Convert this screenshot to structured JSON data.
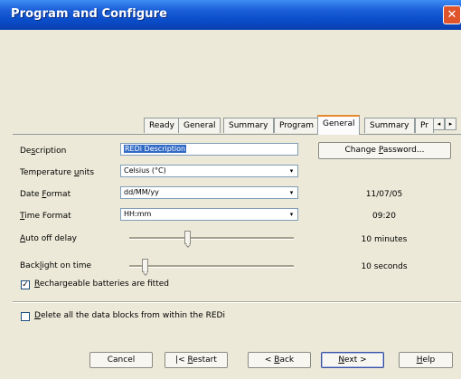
{
  "window": {
    "title": "Program and Configure",
    "close_glyph": "✕"
  },
  "tabs": [
    {
      "label": "Ready"
    },
    {
      "label": "General"
    },
    {
      "label": "Summary"
    },
    {
      "label": "Program"
    },
    {
      "label": "General",
      "active": true
    },
    {
      "label": "Summary"
    },
    {
      "label": "Pr"
    }
  ],
  "tab_scroll": {
    "left_icon": "◂",
    "right_icon": "▸"
  },
  "form": {
    "description": {
      "label_pre": "De",
      "label_ul": "s",
      "label_post": "cription",
      "value": "REDi Description"
    },
    "change_password": {
      "label_pre": "Change ",
      "label_ul": "P",
      "label_post": "assword..."
    },
    "temperature_units": {
      "label_pre": "Temperature ",
      "label_ul": "u",
      "label_post": "nits",
      "value": "Celsius (°C)"
    },
    "date_format": {
      "label_pre": "Date ",
      "label_ul": "F",
      "label_post": "ormat",
      "value": "dd/MM/yy",
      "preview": "11/07/05"
    },
    "time_format": {
      "label_pre": "",
      "label_ul": "T",
      "label_post": "ime Format",
      "value": "HH:mm",
      "preview": "09:20"
    },
    "auto_off_delay": {
      "label_pre": "",
      "label_ul": "A",
      "label_post": "uto off delay",
      "value_text": "10 minutes",
      "level": 0.35
    },
    "backlight_on_time": {
      "label_pre": "Back",
      "label_ul": "l",
      "label_post": "ight on time",
      "value_text": "10 seconds",
      "level": 0.08
    },
    "rechargeable": {
      "label_pre": "",
      "label_ul": "R",
      "label_post": "echargeable batteries are fitted",
      "checked": true,
      "check_glyph": "✓"
    },
    "delete_blocks": {
      "label_pre": "",
      "label_ul": "D",
      "label_post": "elete all the data blocks from within the REDi",
      "checked": false
    }
  },
  "dropdown_icon": "▾",
  "buttons": {
    "cancel": {
      "label": "Cancel"
    },
    "restart": {
      "label_pre": "|< ",
      "label_ul": "R",
      "label_post": "estart"
    },
    "back": {
      "label_pre": "< ",
      "label_ul": "B",
      "label_post": "ack"
    },
    "next": {
      "label_ul": "N",
      "label_post": "ext >"
    },
    "help": {
      "label_ul": "H",
      "label_post": "elp"
    }
  }
}
